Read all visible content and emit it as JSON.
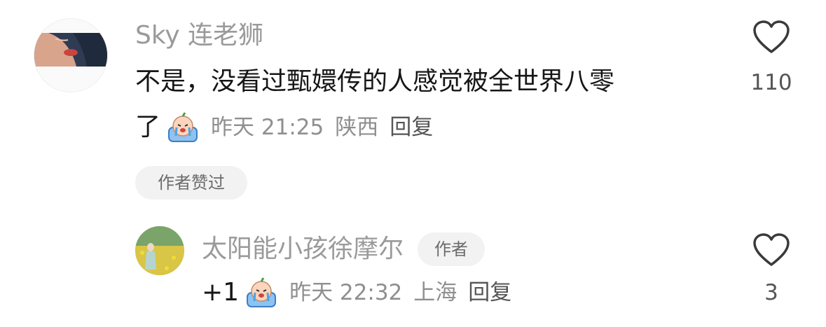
{
  "comment": {
    "username": "Sky 连老狮",
    "text_line1": "不是，没看过甄嬛传的人感觉被全世界八零",
    "text_line2": "了",
    "emoji_icon": "crying-emoji-icon",
    "time": "昨天 21:25",
    "location": "陕西",
    "reply_label": "回复",
    "author_liked_badge": "作者赞过",
    "like_count": "110"
  },
  "reply": {
    "username": "太阳能小孩徐摩尔",
    "author_badge": "作者",
    "text": "+1",
    "emoji_icon": "crying-emoji-icon",
    "time": "昨天 22:32",
    "location": "上海",
    "reply_label": "回复",
    "like_count": "3"
  },
  "colors": {
    "name_gray": "#9a9a9a",
    "text_black": "#161616",
    "badge_bg": "#f2f2f2"
  }
}
